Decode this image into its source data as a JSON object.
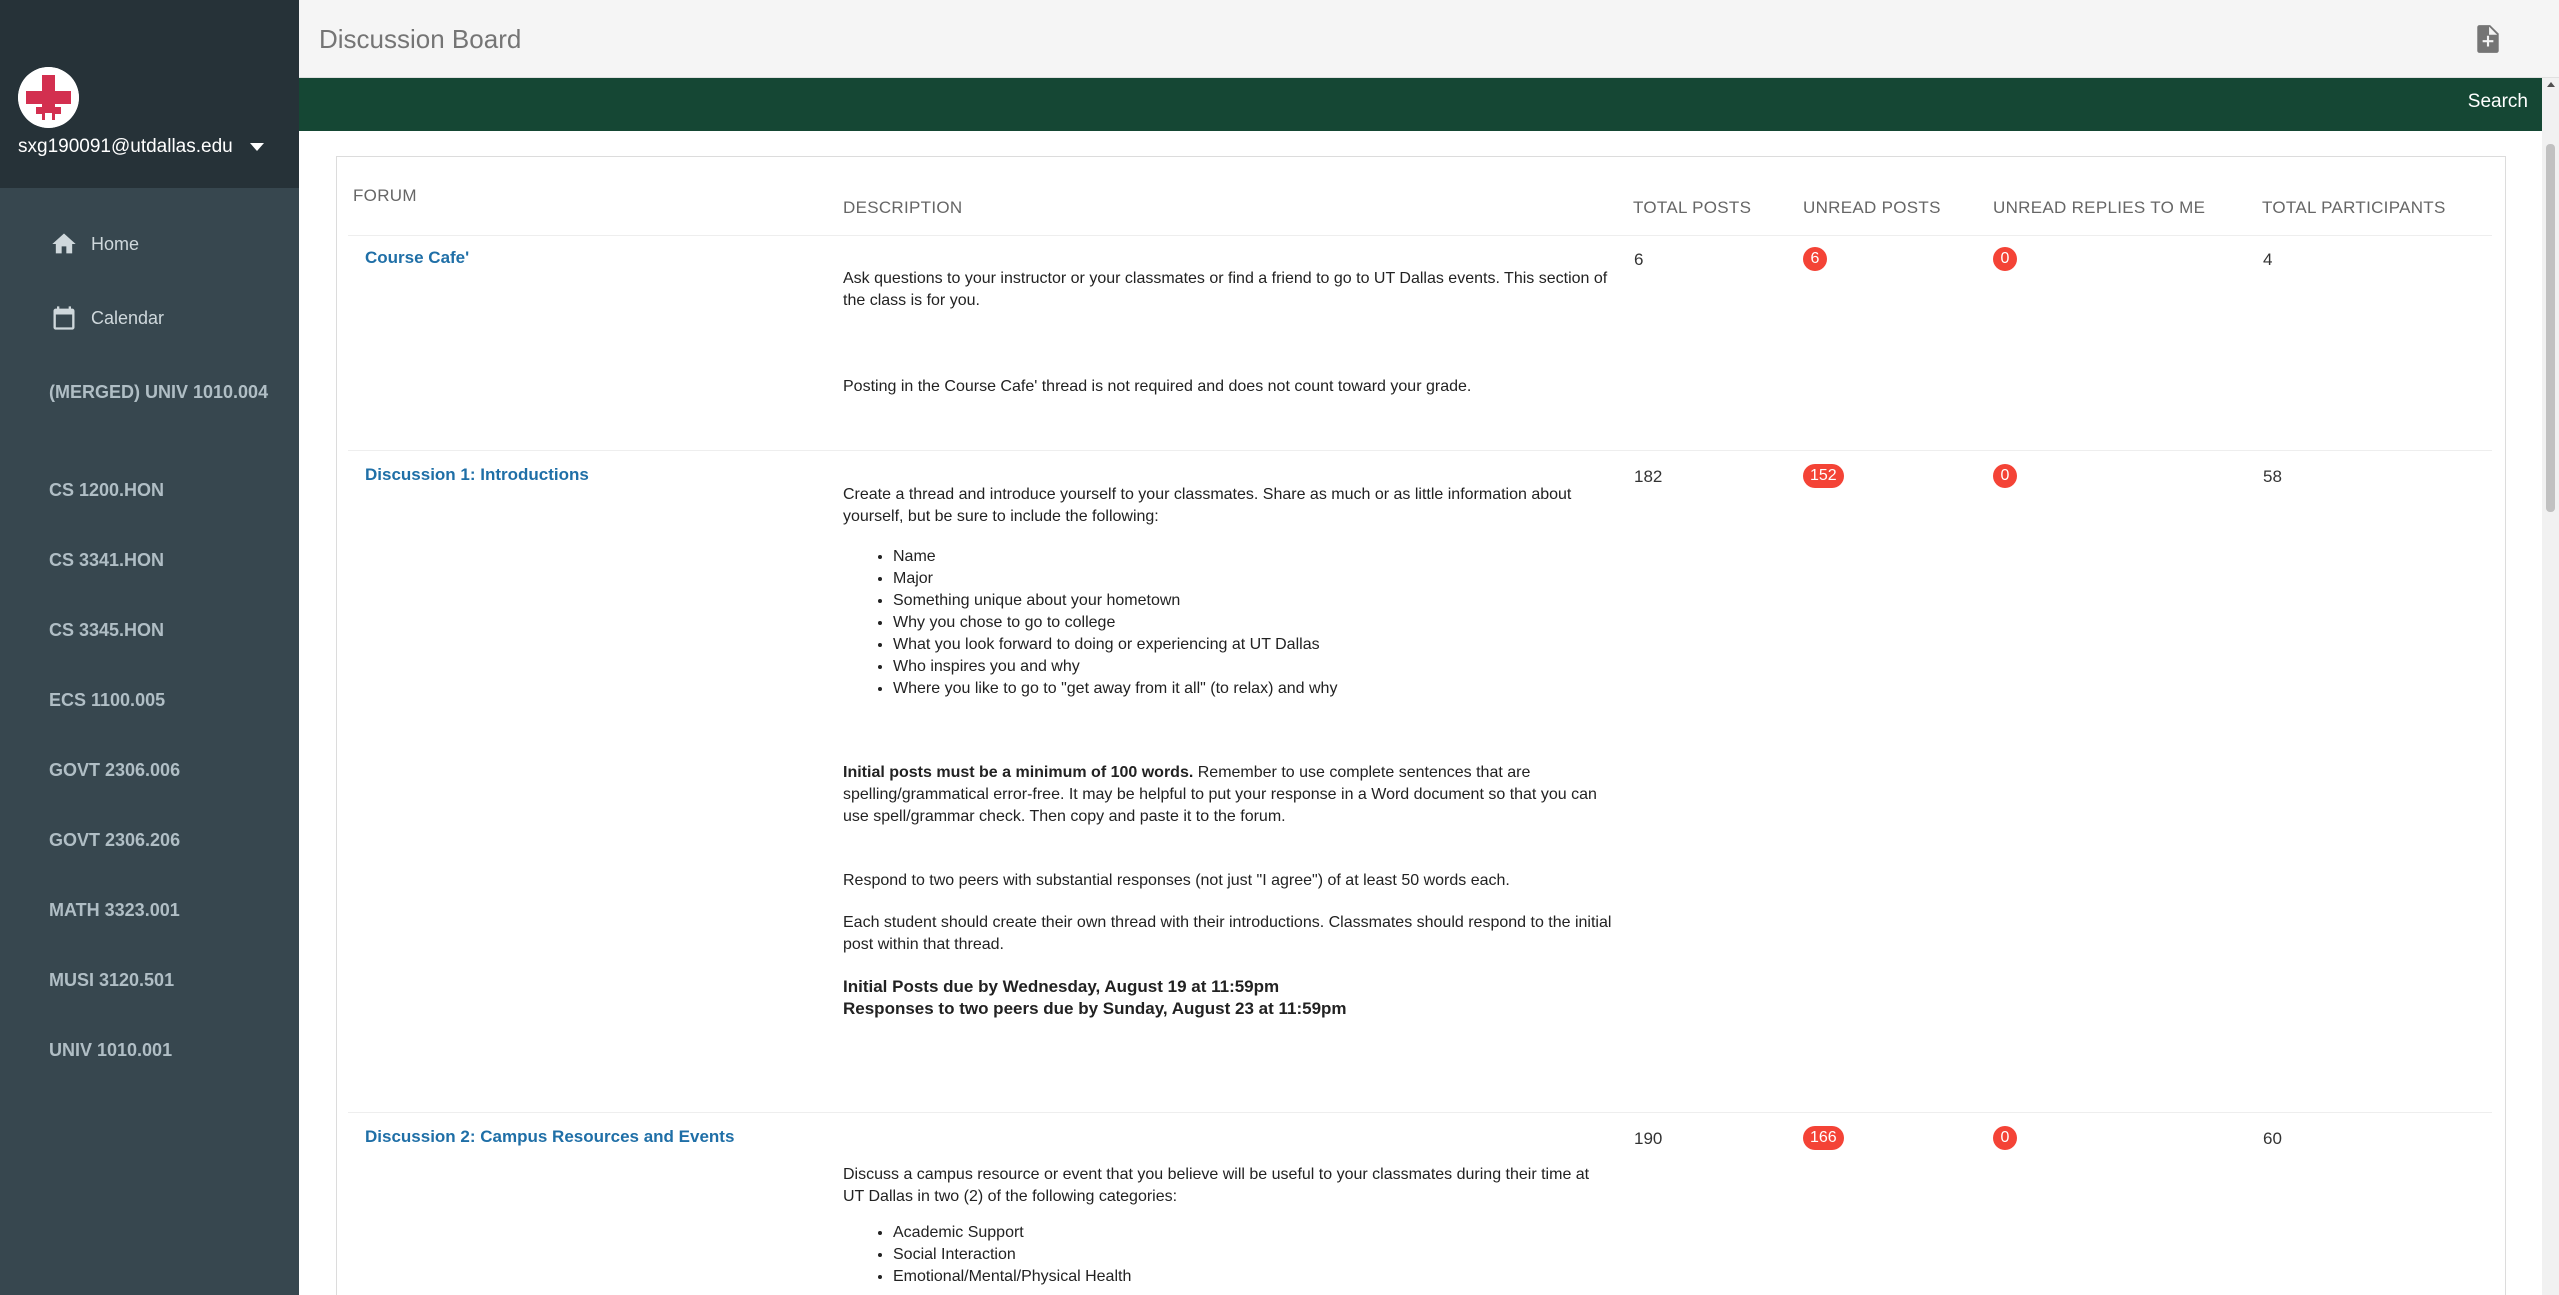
{
  "user": {
    "email": "sxg190091@utdallas.edu"
  },
  "nav": {
    "home": "Home",
    "calendar": "Calendar",
    "courses": [
      "(MERGED) UNIV 1010.004",
      "CS 1200.HON",
      "CS 3341.HON",
      "CS 3345.HON",
      "ECS 1100.005",
      "GOVT 2306.006",
      "GOVT 2306.206",
      "MATH 3323.001",
      "MUSI 3120.501",
      "UNIV 1010.001"
    ]
  },
  "header": {
    "title": "Discussion Board",
    "search_label": "Search"
  },
  "table": {
    "headers": {
      "forum": "FORUM",
      "description": "DESCRIPTION",
      "total_posts": "TOTAL POSTS",
      "unread_posts": "UNREAD POSTS",
      "unread_replies": "UNREAD REPLIES TO ME",
      "total_participants": "TOTAL PARTICIPANTS"
    },
    "rows": [
      {
        "forum": "Course Cafe'",
        "total_posts": "6",
        "unread_posts": "6",
        "unread_replies": "0",
        "participants": "4",
        "desc_p1": "Ask questions to your instructor or your classmates or find a friend to go to UT Dallas events. This section of the class is for you.",
        "desc_p2": "Posting in the Course Cafe' thread is not required and does not count toward your grade."
      },
      {
        "forum": "Discussion 1: Introductions",
        "total_posts": "182",
        "unread_posts": "152",
        "unread_replies": "0",
        "participants": "58",
        "desc_intro": "Create a thread and introduce yourself to your classmates. Share as much or as little information about yourself, but be sure to include the following:",
        "list": [
          "Name",
          "Major",
          "Something unique about your hometown",
          "Why you chose to go to college",
          "What you look forward to doing or experiencing at UT Dallas",
          "Who inspires you and why",
          "Where you like to go to \"get away from it all\" (to relax) and why"
        ],
        "desc_bold": "Initial posts must be a minimum of 100 words.",
        "desc_after_bold": " Remember to use complete sentences that are spelling/grammatical error-free. It may be helpful to put your response in a Word document so that you can use spell/grammar check. Then copy and paste it to the forum.",
        "desc_respond": "Respond to two peers with substantial responses (not just \"I agree\") of at least 50 words each.",
        "desc_each": "Each student should create their own thread with their introductions. Classmates should respond to the initial post within that thread.",
        "due1": "Initial Posts due by Wednesday, August 19 at 11:59pm",
        "due2": "Responses to two peers due by Sunday, August 23 at 11:59pm"
      },
      {
        "forum": "Discussion 2: Campus Resources and Events",
        "total_posts": "190",
        "unread_posts": "166",
        "unread_replies": "0",
        "participants": "60",
        "desc_intro": "Discuss a campus resource or event that you believe will be useful to your classmates during their time at UT Dallas in two (2) of the following categories:",
        "list": [
          "Academic Support",
          "Social Interaction",
          "Emotional/Mental/Physical Health"
        ]
      }
    ]
  },
  "colors": {
    "sidebar": "#37474f",
    "sidebar_top": "#263238",
    "green_bar": "#154734",
    "badge": "#f44336",
    "link": "#1f6fa7"
  }
}
